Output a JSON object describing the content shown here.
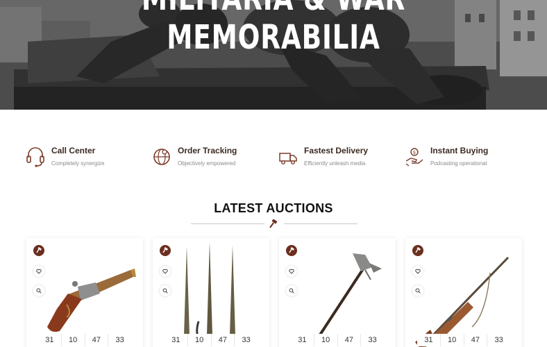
{
  "hero": {
    "title_line1": "MILITARIA & WAR",
    "title_line2": "MEMORABILIA"
  },
  "colors": {
    "accent": "#6b2f1f",
    "icon": "#7a3a28",
    "title_text": "#3a2a22"
  },
  "features": [
    {
      "title": "Call Center",
      "subtitle": "Completely synergize",
      "icon": "headset-icon"
    },
    {
      "title": "Order Tracking",
      "subtitle": "Objectively empowered",
      "icon": "globe-tracking-icon"
    },
    {
      "title": "Fastest Delivery",
      "subtitle": "Efficiently unleash media",
      "icon": "truck-icon"
    },
    {
      "title": "Instant Buying",
      "subtitle": "Podcasting operational",
      "icon": "money-hand-icon"
    }
  ],
  "section": {
    "title": "LATEST AUCTIONS",
    "divider_icon": "gavel-icon"
  },
  "cards": [
    {
      "image": "flintlock-pistol",
      "countdown": [
        "31",
        "10",
        "47",
        "33"
      ]
    },
    {
      "image": "bayonets",
      "countdown": [
        "31",
        "10",
        "47",
        "33"
      ]
    },
    {
      "image": "war-axe",
      "countdown": [
        "31",
        "10",
        "47",
        "33"
      ]
    },
    {
      "image": "rifle",
      "countdown": [
        "31",
        "10",
        "47",
        "33"
      ]
    }
  ]
}
